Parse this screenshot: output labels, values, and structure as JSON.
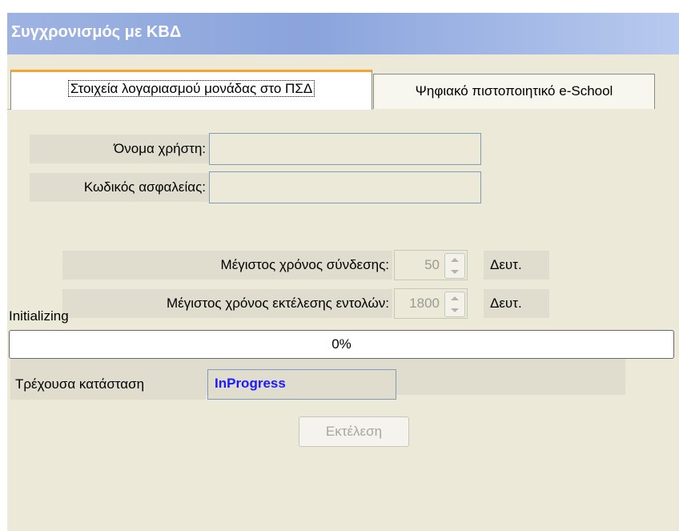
{
  "window": {
    "title": "Συγχρονισμός με ΚΒΔ"
  },
  "tabs": [
    {
      "label": "Στοιχεία λογαριασμού μονάδας στο ΠΣΔ",
      "active": true
    },
    {
      "label": "Ψηφιακό πιστοποιητικό e-School",
      "active": false
    }
  ],
  "account": {
    "username_label": "Όνομα χρήστη:",
    "username_value": "",
    "password_label": "Κωδικός ασφαλείας:",
    "password_value": ""
  },
  "timeouts": {
    "connect_label": "Μέγιστος χρόνος σύνδεσης:",
    "connect_value": "50",
    "connect_unit": "Δευτ.",
    "exec_label": "Μέγιστος χρόνος εκτέλεσης εντολών:",
    "exec_value": "1800",
    "exec_unit": "Δευτ."
  },
  "progress": {
    "status_text": "Initializing",
    "percent_text": "0%",
    "percent": 0
  },
  "state": {
    "label": "Τρέχουσα κατάσταση",
    "value": "InProgress"
  },
  "actions": {
    "run_label": "Εκτέλεση"
  },
  "colors": {
    "state_value": "#1a1aff",
    "active_tab_accent": "#f7a531"
  }
}
